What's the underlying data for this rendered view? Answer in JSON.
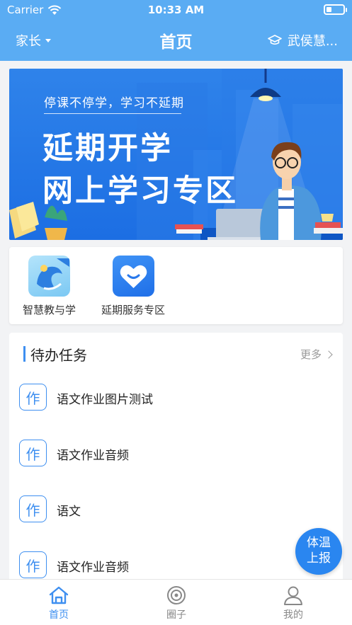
{
  "status_bar": {
    "carrier": "Carrier",
    "time": "10:33 AM",
    "wifi_icon": "wifi-icon",
    "battery_icon": "battery-icon"
  },
  "navbar": {
    "role": "家长",
    "title": "首页",
    "school": "武侯慧...",
    "school_icon": "graduation-cap-icon"
  },
  "banner": {
    "subtitle": "停课不停学，学习不延期",
    "title_line1": "延期开学",
    "title_line2": "网上学习专区"
  },
  "apps": [
    {
      "label": "智慧教与学",
      "icon": "smart-learning-icon"
    },
    {
      "label": "延期服务专区",
      "icon": "heart-smile-icon"
    }
  ],
  "tasks": {
    "title": "待办任务",
    "more": "更多",
    "badge": "作",
    "items": [
      {
        "name": "语文作业图片测试"
      },
      {
        "name": "语文作业音频"
      },
      {
        "name": "语文"
      },
      {
        "name": "语文作业音频"
      }
    ]
  },
  "fab": {
    "line1": "体温",
    "line2": "上报"
  },
  "tabbar": {
    "active": "home",
    "items": [
      {
        "label": "首页",
        "icon": "home-icon"
      },
      {
        "label": "圈子",
        "icon": "circle-icon"
      },
      {
        "label": "我的",
        "icon": "profile-icon"
      }
    ]
  },
  "colors": {
    "header": "#5aacf3",
    "accent": "#3e8ff0",
    "banner": "#1c6ee3"
  }
}
